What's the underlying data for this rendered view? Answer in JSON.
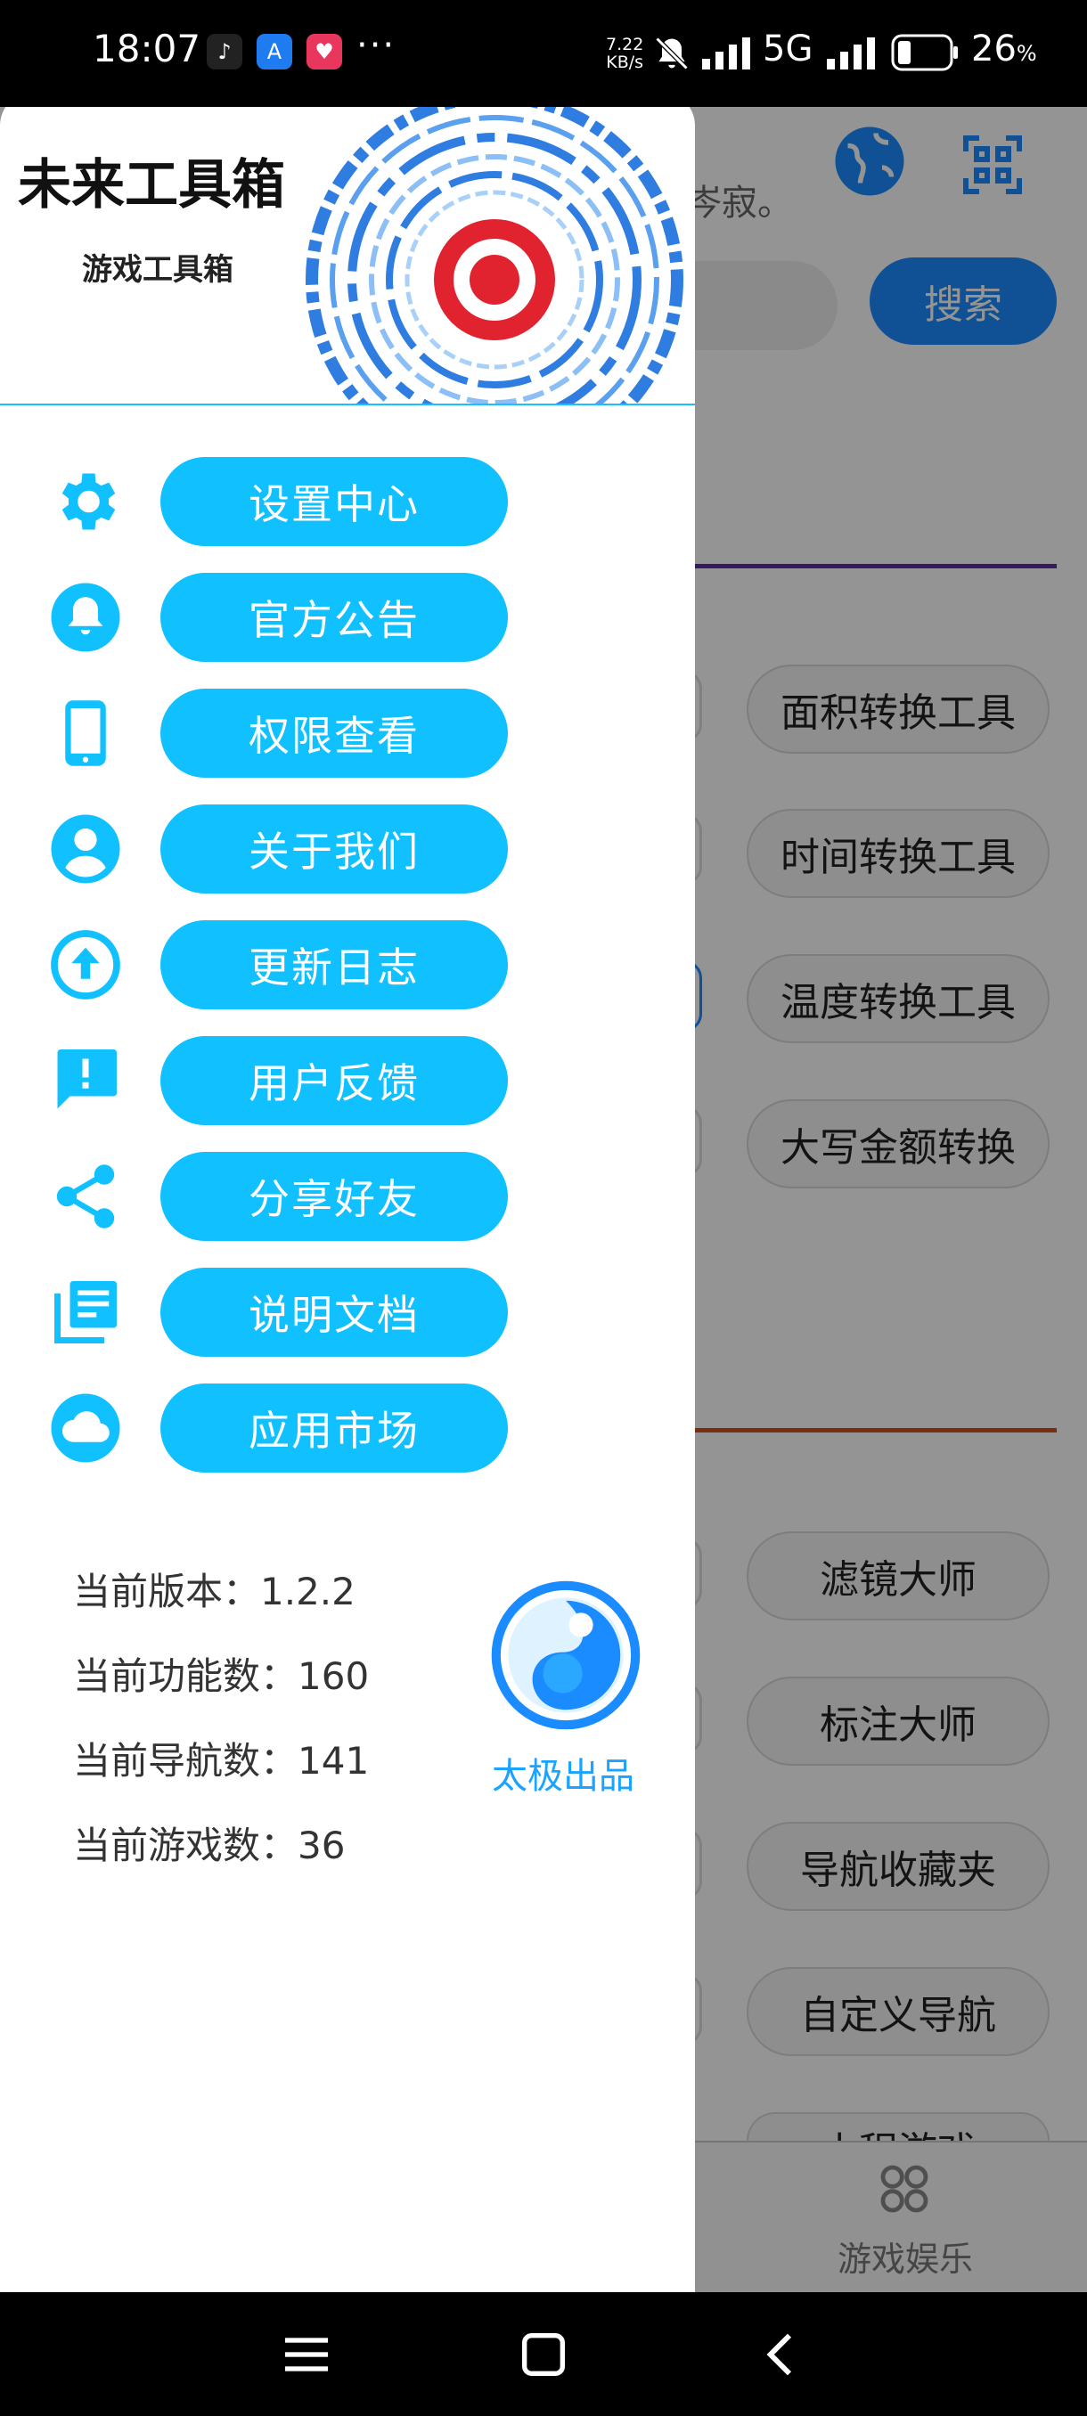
{
  "status_bar": {
    "time": "18:07",
    "more": "···",
    "net_speed_value": "7.22",
    "net_speed_unit": "KB/s",
    "network": "5G",
    "battery": "26",
    "battery_unit": "%",
    "battery_level": 0.26
  },
  "background": {
    "hint_text": "岑寂。",
    "search_button": "搜索",
    "tools_section_1": [
      "面积转换工具",
      "时间转换工具",
      "温度转换工具",
      "大写金额转换"
    ],
    "tools_section_2": [
      "滤镜大师",
      "标注大师",
      "导航收藏夹",
      "自定义导航"
    ],
    "partial_item": "小程游戏",
    "bottom_nav_label": "游戏娱乐"
  },
  "drawer": {
    "title": "未来工具箱",
    "subtitle": "游戏工具箱",
    "menu": [
      {
        "icon": "gear-icon",
        "label": "设置中心"
      },
      {
        "icon": "bell-icon",
        "label": "官方公告"
      },
      {
        "icon": "phone-icon",
        "label": "权限查看"
      },
      {
        "icon": "user-icon",
        "label": "关于我们"
      },
      {
        "icon": "upload-icon",
        "label": "更新日志"
      },
      {
        "icon": "feedback-icon",
        "label": "用户反馈"
      },
      {
        "icon": "share-icon",
        "label": "分享好友"
      },
      {
        "icon": "document-icon",
        "label": "说明文档"
      },
      {
        "icon": "cloud-icon",
        "label": "应用市场"
      }
    ],
    "info": {
      "version": "当前版本：1.2.2",
      "features": "当前功能数：160",
      "navigations": "当前导航数：141",
      "games": "当前游戏数：36"
    },
    "brand": "太极出品"
  },
  "colors": {
    "accent": "#10c0ff",
    "brand_text": "#1aa3ff",
    "bg_blue": "#1a8cff",
    "divider_purple": "#5a2ea6",
    "divider_orange": "#d4501a"
  }
}
